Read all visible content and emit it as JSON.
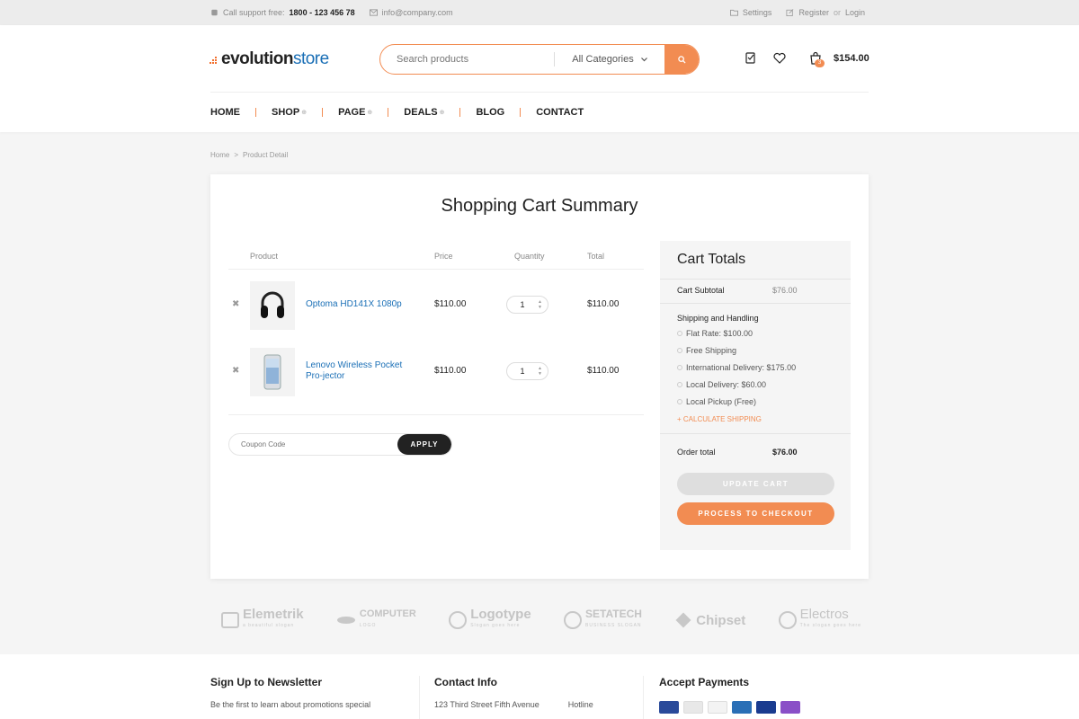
{
  "topbar": {
    "support_label": "Call support free:",
    "support_phone": "1800 - 123 456 78",
    "email": "info@company.com",
    "settings": "Settings",
    "register": "Register",
    "or": "or",
    "login": "Login"
  },
  "header": {
    "logo_part1": "evolution",
    "logo_part2": "store",
    "search_placeholder": "Search products",
    "category_selected": "All Categories",
    "cart_count": "3",
    "cart_total": "$154.00"
  },
  "nav": {
    "items": [
      {
        "label": "HOME",
        "has_sub": false
      },
      {
        "label": "SHOP",
        "has_sub": true
      },
      {
        "label": "PAGE",
        "has_sub": true
      },
      {
        "label": "DEALS",
        "has_sub": true
      },
      {
        "label": "BLOG",
        "has_sub": false
      },
      {
        "label": "CONTACT",
        "has_sub": false
      }
    ]
  },
  "breadcrumb": {
    "home": "Home",
    "sep": ">",
    "current": "Product Detail"
  },
  "cart": {
    "title": "Shopping Cart Summary",
    "columns": {
      "product": "Product",
      "price": "Price",
      "quantity": "Quantity",
      "total": "Total"
    },
    "items": [
      {
        "name": "Optoma HD141X 1080p",
        "price": "$110.00",
        "qty": "1",
        "total": "$110.00",
        "thumb": "headphones-icon"
      },
      {
        "name": "Lenovo Wireless Pocket Pro-jector",
        "price": "$110.00",
        "qty": "1",
        "total": "$110.00",
        "thumb": "smartphone-icon"
      }
    ],
    "remove_symbol": "✖",
    "coupon_placeholder": "Coupon Code",
    "apply_label": "APPLY"
  },
  "totals": {
    "title": "Cart Totals",
    "subtotal_label": "Cart Subtotal",
    "subtotal_value": "$76.00",
    "shipping_label": "Shipping and Handling",
    "shipping_options": [
      "Flat Rate: $100.00",
      "Free Shipping",
      "International Delivery: $175.00",
      "Local Delivery: $60.00",
      "Local Pickup (Free)"
    ],
    "calculate_label": "+ CALCULATE SHIPPING",
    "order_total_label": "Order total",
    "order_total_value": "$76.00",
    "update_label": "UPDATE CART",
    "checkout_label": "PROCESS TO CHECKOUT"
  },
  "brands": [
    {
      "name": "Elemetrik",
      "tagline": "a beautiful slogan"
    },
    {
      "name": "COMPUTER",
      "tagline": "LOGO"
    },
    {
      "name": "Logotype",
      "tagline": "Slogan goes here"
    },
    {
      "name": "SETATECH",
      "tagline": "BUSINESS SLOGAN"
    },
    {
      "name": "Chipset",
      "tagline": ""
    },
    {
      "name": "Electros",
      "tagline": "The slogan goes here"
    }
  ],
  "footer": {
    "newsletter_title": "Sign Up to Newsletter",
    "newsletter_text": "Be the first to learn about promotions special",
    "contact_title": "Contact Info",
    "contact_address": "123 Third Street Fifth Avenue",
    "contact_hotline": "Hotline",
    "payments_title": "Accept Payments",
    "payment_colors": [
      "#2a4a9a",
      "#e33",
      "#ddd",
      "#2a6fb6",
      "#1a3b8f",
      "#8a4fc7"
    ]
  },
  "colors": {
    "accent": "#f28c52",
    "link": "#1a6fb6",
    "dark": "#222222"
  }
}
